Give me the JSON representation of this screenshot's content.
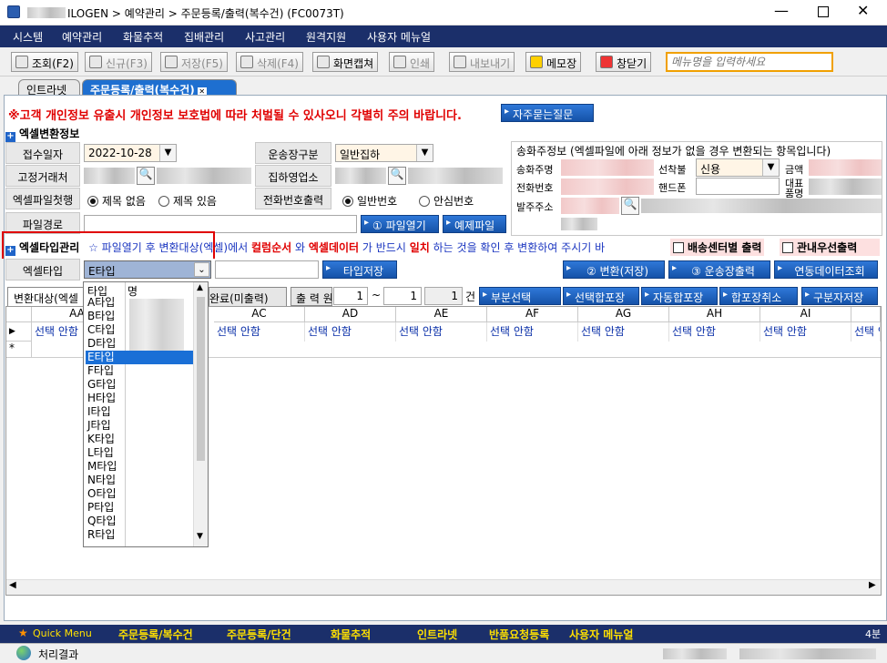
{
  "window": {
    "title": "ILOGEN > 예약관리 > 주문등록/출력(복수건) (FC0073T)"
  },
  "menu": [
    "시스템",
    "예약관리",
    "화물추적",
    "집배관리",
    "사고관리",
    "원격지원",
    "사용자 메뉴얼"
  ],
  "toolbar": {
    "buttons": [
      "조회(F2)",
      "신규(F3)",
      "저장(F5)",
      "삭제(F4)",
      "화면캡쳐",
      "인쇄",
      "내보내기",
      "메모장",
      "창닫기"
    ],
    "menu_search_placeholder": "메뉴명을 입력하세요"
  },
  "tabs": [
    "인트라넷",
    "주문등록/출력(복수건)"
  ],
  "warning": "※고객 개인정보 유출시 개인정보 보호법에 따라 처벌될 수 있사오니 각별히 주의 바랍니다.",
  "faq_button": "자주묻는질문",
  "excel_info": {
    "title": "엑셀변환정보",
    "receipt_date_label": "접수일자",
    "receipt_date": "2022-10-28",
    "transport_label": "운송장구분",
    "transport_value": "일반집하",
    "fixed_client_label": "고정거래처",
    "pickup_office_label": "집하영업소",
    "first_row_label": "엑셀파일첫행",
    "radio_no_title": "제목 없음",
    "radio_with_title": "제목 있음",
    "phone_output_label": "전화번호출력",
    "radio_normal_phone": "일반번호",
    "radio_safe_phone": "안심번호",
    "file_path_label": "파일경로",
    "open_file_button": "① 파일열기",
    "example_file_button": "예제파일"
  },
  "sender_info": {
    "title": "송화주정보 (엑셀파일에 아래 정보가 없을 경우 변환되는 항목입니다)",
    "sender_name": "송화주명",
    "fare_type_label": "선착불",
    "fare_type": "신용",
    "amount": "금액",
    "phone": "전화번호",
    "mobile": "핸드폰",
    "rep_product_1": "대표",
    "rep_product_2": "품명",
    "order_address": "발주주소"
  },
  "excel_type": {
    "title": "엑셀타입관리",
    "notice_prefix": "☆ 파일열기 후 변환대상(엑셀)에서",
    "notice_col": "컬럼순서",
    "notice_and": "와",
    "notice_data": "엑셀데이터",
    "notice_mid": "가 반드시",
    "notice_match": "일치",
    "notice_suffix": "하는 것을 확인 후 변환하여 주시기 바",
    "per_center_print": "배송센터별 출력",
    "in_priority_print": "관내우선출력",
    "type_label": "엑셀타입",
    "type_value": "E타입",
    "save_type_button": "타입저장",
    "convert_button": "② 변환(저장)",
    "waybill_print_button": "③ 운송장출력",
    "linked_data_button": "연동데이터조회"
  },
  "subtabs": {
    "convert_target": "변환대상(엑셀",
    "convert_done": "완료(미출력)",
    "print_range_label": "출 력 원",
    "from": "1",
    "tilde": "~",
    "to": "1",
    "count": "1",
    "count_unit": "건"
  },
  "action_buttons": [
    "부분선택",
    "선택합포장",
    "자동합포장",
    "합포장취소",
    "구분자저장"
  ],
  "grid": {
    "columns": [
      "AA",
      "AC",
      "AD",
      "AE",
      "AF",
      "AG",
      "AH",
      "AI"
    ],
    "cell_value": "선택 안함"
  },
  "dropdown": {
    "header": [
      "타입",
      "명"
    ],
    "options": [
      "A타입",
      "B타입",
      "C타입",
      "D타입",
      "E타입",
      "F타입",
      "G타입",
      "H타입",
      "I타입",
      "J타입",
      "K타입",
      "L타입",
      "M타입",
      "N타입",
      "O타입",
      "P타입",
      "Q타입",
      "R타입"
    ],
    "selected": "E타입"
  },
  "statusbar": {
    "quick_menu": "Quick Menu",
    "links": [
      "주문등록/복수건",
      "주문등록/단건",
      "화물추적",
      "인트라넷",
      "반품요청등록",
      "사용자 메뉴얼"
    ],
    "right": "4분"
  },
  "bottom": {
    "label": "처리결과"
  }
}
